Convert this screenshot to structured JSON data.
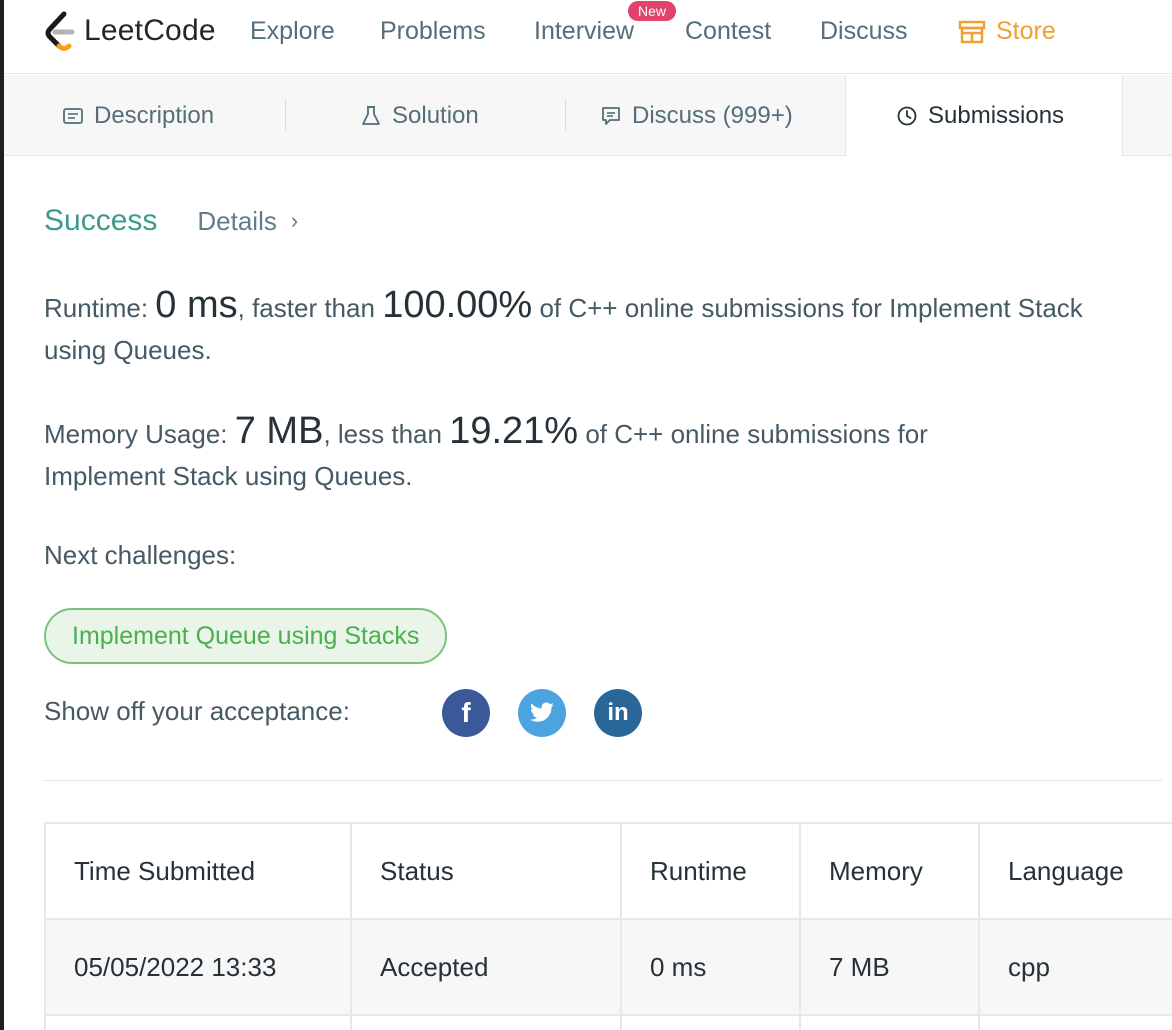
{
  "brand": {
    "name": "LeetCode"
  },
  "nav": {
    "items": [
      "Explore",
      "Problems",
      "Interview",
      "Contest",
      "Discuss"
    ],
    "new_badge": "New",
    "store": "Store"
  },
  "tabs": {
    "description": "Description",
    "solution": "Solution",
    "discuss": "Discuss (999+)",
    "submissions": "Submissions"
  },
  "result": {
    "status": "Success",
    "details": "Details",
    "runtime_label": "Runtime:",
    "runtime_value": "0 ms",
    "runtime_mid": ", faster than",
    "runtime_pct": "100.00%",
    "runtime_tail": "of C++ online submissions for Implement Stack using Queues.",
    "memory_label": "Memory Usage:",
    "memory_value": "7 MB",
    "memory_mid": ", less than",
    "memory_pct": "19.21%",
    "memory_tail": "of C++ online submissions for Implement Stack using Queues.",
    "next_label": "Next challenges:",
    "next_challenge": "Implement Queue using Stacks",
    "showoff": "Show off your acceptance:"
  },
  "social": {
    "facebook": "f",
    "linkedin": "in"
  },
  "table": {
    "headers": [
      "Time Submitted",
      "Status",
      "Runtime",
      "Memory",
      "Language"
    ],
    "rows": [
      {
        "time": "05/05/2022 13:33",
        "status": "Accepted",
        "runtime": "0 ms",
        "memory": "7 MB",
        "language": "cpp"
      }
    ]
  },
  "colors": {
    "success": "#3d9b8c",
    "store": "#f0a030",
    "badge": "#e0436b",
    "pill_border": "#7cc27f",
    "facebook": "#3b5998",
    "twitter": "#4ba3e0",
    "linkedin": "#2a6798"
  }
}
